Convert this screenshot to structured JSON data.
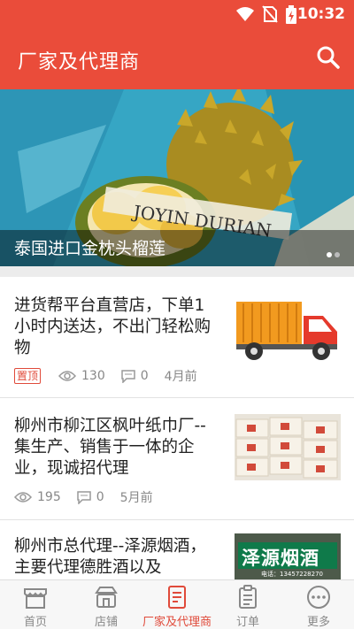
{
  "status_bar": {
    "time": "10:32"
  },
  "app_bar": {
    "title": "厂家及代理商",
    "search_icon": "search-icon"
  },
  "banner": {
    "caption": "泰国进口金枕头榴莲",
    "artwork_text": "JOYIN DURIAN",
    "page_count": 2,
    "active_page": 1
  },
  "list": [
    {
      "title": "进货帮平台直营店，下单1小时内送达，不出门轻松购物",
      "badge": "置顶",
      "views": "130",
      "comments": "0",
      "time": "4月前",
      "thumbnail": "delivery-truck"
    },
    {
      "title": "柳州市柳江区枫叶纸巾厂--集生产、销售于一体的企业，现诚招代理",
      "views": "195",
      "comments": "0",
      "time": "5月前",
      "thumbnail": "tissue-boxes"
    },
    {
      "title": "柳州市总代理--泽源烟酒，主要代理德胜酒以及",
      "thumbnail_sign": "泽源烟酒",
      "thumbnail_subtext": "电话：13457228270",
      "thumbnail": "shop-sign"
    }
  ],
  "bottom_nav": [
    {
      "label": "首页",
      "icon": "shop-icon"
    },
    {
      "label": "店铺",
      "icon": "store-icon"
    },
    {
      "label": "厂家及代理商",
      "icon": "document-icon",
      "active": true
    },
    {
      "label": "订单",
      "icon": "order-list-icon"
    },
    {
      "label": "更多",
      "icon": "more-icon"
    }
  ],
  "colors": {
    "primary": "#ea4c3a",
    "accent": "#e04a3a",
    "muted": "#888888"
  }
}
